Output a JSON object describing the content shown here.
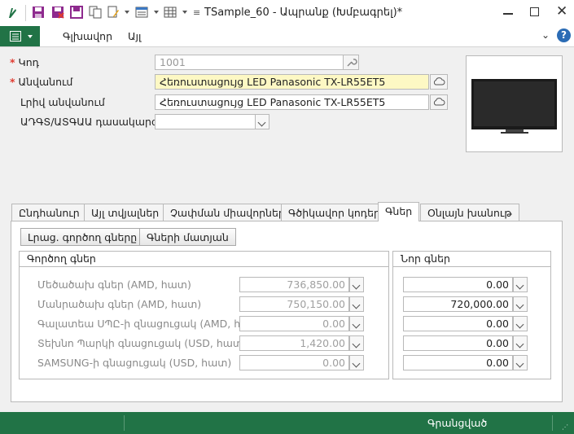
{
  "window": {
    "title": "TSample_60 - Ապրանք (Խմբագրել)*"
  },
  "ribbon": {
    "tabs": [
      "Գլխավոր",
      "Այլ"
    ]
  },
  "form": {
    "code_label": "Կոդ",
    "code_value": "1001",
    "name_label": "Անվանում",
    "name_value": "Հեռուստացույց LED Panasonic TX-LR55ET5",
    "fullname_label": "Լրիվ անվանում",
    "fullname_value": "Հեռուստացույց LED Panasonic TX-LR55ET5",
    "class_label": "ԱԴԳՏ/ԱՏԳԱԱ դասակարգիչ",
    "class_value": ""
  },
  "tabs": [
    "Ընդհանուր",
    "Այլ տվյալներ",
    "Չափման միավորներ",
    "Գծիկավոր կոդեր",
    "Գներ",
    "Օնլայն խանութ"
  ],
  "prices": {
    "btn_fill": "Լրաց. գործող գները",
    "btn_history": "Գների մատյան",
    "current_head": "Գործող գներ",
    "new_head": "Նոր գներ",
    "rows": [
      {
        "label": "Մեծածախ գներ (AMD, հատ)",
        "current": "736,850.00",
        "new": "0.00"
      },
      {
        "label": "Մանրածախ գներ (AMD, հատ)",
        "current": "750,150.00",
        "new": "720,000.00"
      },
      {
        "label": "Գալատեա ՍՊԸ-ի զնացուցակ (AMD, հատ)",
        "current": "0.00",
        "new": "0.00"
      },
      {
        "label": "Տեխնո Պարկի գնացուցակ (USD, հատ)",
        "current": "1,420.00",
        "new": "0.00"
      },
      {
        "label": "SAMSUNG-ի գնացուցակ (USD, հատ)",
        "current": "0.00",
        "new": "0.00"
      }
    ]
  },
  "status": {
    "text": "Գրանցված"
  },
  "colors": {
    "accent": "#217346",
    "required": "#e03c31",
    "name_highlight": "#fdf8c4"
  }
}
